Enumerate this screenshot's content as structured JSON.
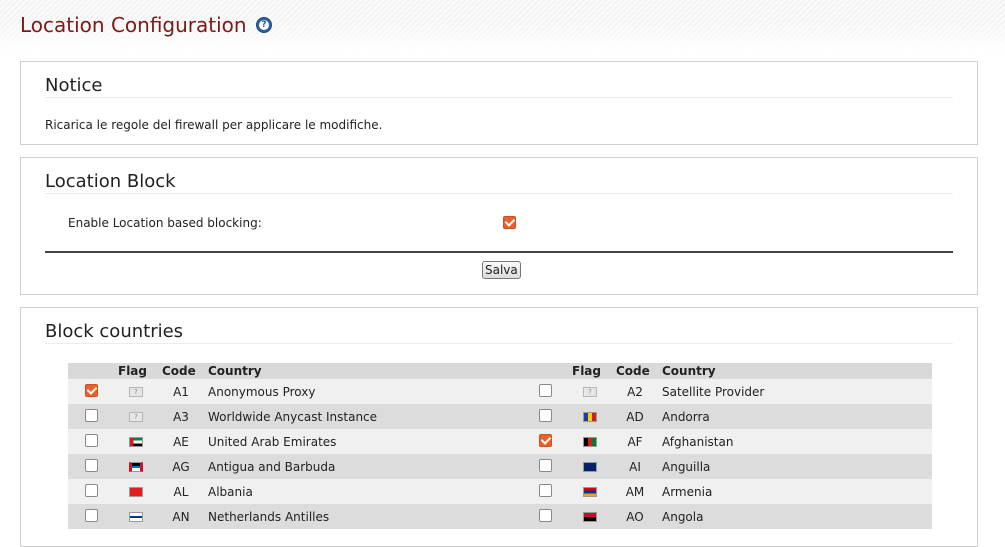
{
  "header": {
    "title": "Location Configuration",
    "help_icon": "help-icon"
  },
  "notice": {
    "title": "Notice",
    "text": "Ricarica le regole del firewall per applicare le modifiche."
  },
  "location_block": {
    "title": "Location Block",
    "enable_label": "Enable Location based blocking:",
    "enabled": true,
    "save_label": "Salva"
  },
  "block_countries": {
    "title": "Block countries",
    "columns": {
      "flag": "Flag",
      "code": "Code",
      "country": "Country"
    },
    "rows": [
      [
        {
          "checked": true,
          "flag": "unknown",
          "code": "A1",
          "country": "Anonymous Proxy"
        },
        {
          "checked": false,
          "flag": "unknown",
          "code": "A2",
          "country": "Satellite Provider"
        }
      ],
      [
        {
          "checked": false,
          "flag": "unknown",
          "code": "A3",
          "country": "Worldwide Anycast Instance"
        },
        {
          "checked": false,
          "flag": "andorra",
          "code": "AD",
          "country": "Andorra"
        }
      ],
      [
        {
          "checked": false,
          "flag": "uae",
          "code": "AE",
          "country": "United Arab Emirates"
        },
        {
          "checked": true,
          "flag": "afghanistan",
          "code": "AF",
          "country": "Afghanistan"
        }
      ],
      [
        {
          "checked": false,
          "flag": "antigua",
          "code": "AG",
          "country": "Antigua and Barbuda"
        },
        {
          "checked": false,
          "flag": "anguilla",
          "code": "AI",
          "country": "Anguilla"
        }
      ],
      [
        {
          "checked": false,
          "flag": "albania",
          "code": "AL",
          "country": "Albania"
        },
        {
          "checked": false,
          "flag": "armenia",
          "code": "AM",
          "country": "Armenia"
        }
      ],
      [
        {
          "checked": false,
          "flag": "netherlands-antilles",
          "code": "AN",
          "country": "Netherlands Antilles"
        },
        {
          "checked": false,
          "flag": "angola",
          "code": "AO",
          "country": "Angola"
        }
      ]
    ]
  },
  "colors": {
    "title": "#7a1a1a",
    "checkbox_checked": "#e8612c",
    "header_row": "#d9d9d9"
  }
}
